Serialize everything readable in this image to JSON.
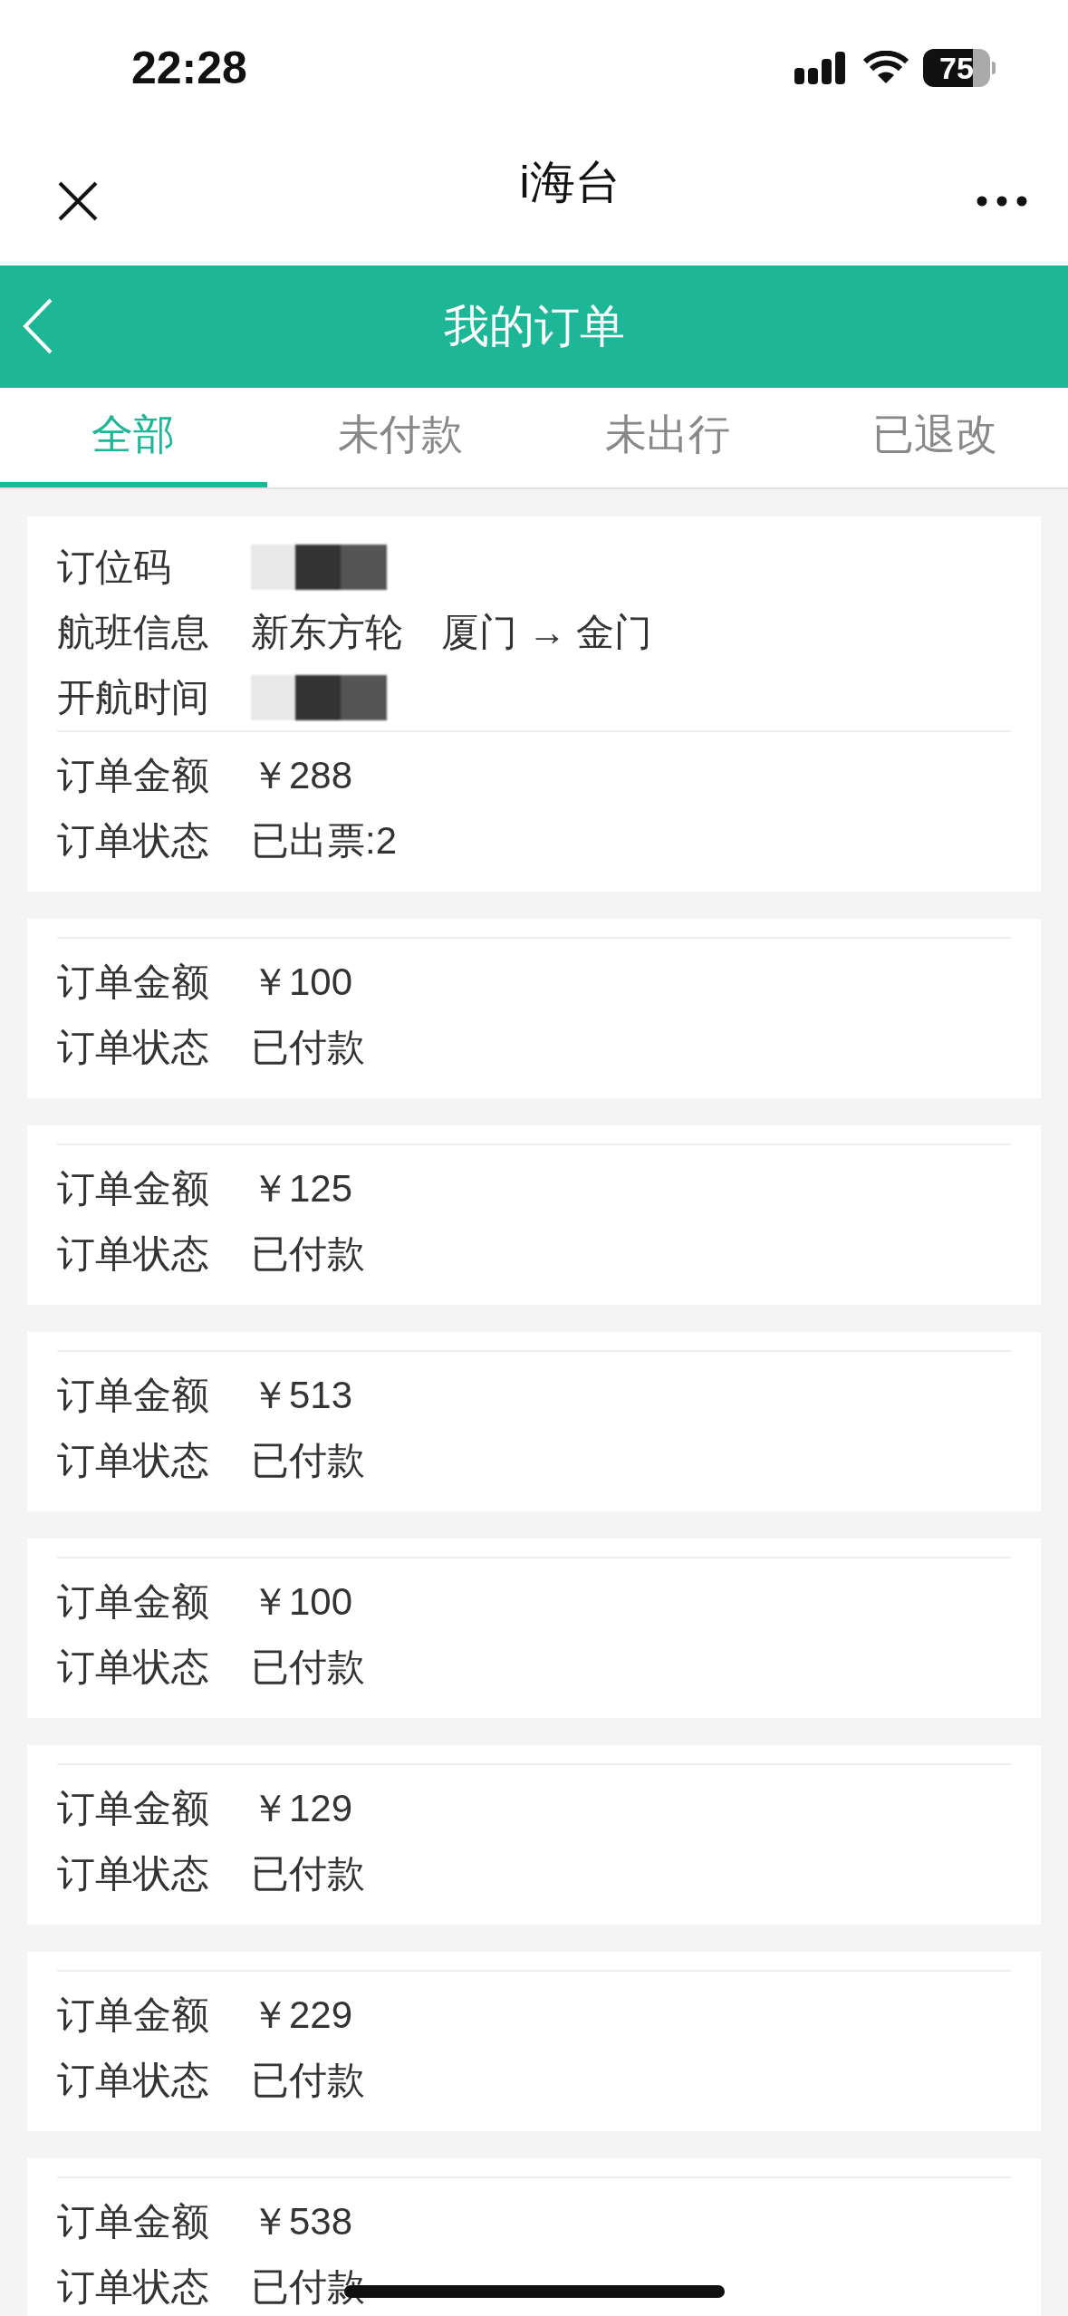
{
  "status_bar": {
    "time": "22:28",
    "battery": "75"
  },
  "nav": {
    "title": "i海台"
  },
  "header": {
    "title": "我的订单"
  },
  "tabs": [
    {
      "label": "全部",
      "selected": true
    },
    {
      "label": "未付款",
      "selected": false
    },
    {
      "label": "未出行",
      "selected": false
    },
    {
      "label": "已退改",
      "selected": false
    }
  ],
  "orders": [
    {
      "details": [
        {
          "label": "订位码",
          "redacted": true
        },
        {
          "label": "航班信息",
          "value": "新东方轮　厦门 → 金门"
        },
        {
          "label": "开航时间",
          "redacted": true
        }
      ],
      "amount_label": "订单金额",
      "amount": "￥288",
      "status_label": "订单状态",
      "status": "已出票:2"
    },
    {
      "amount_label": "订单金额",
      "amount": "￥100",
      "status_label": "订单状态",
      "status": "已付款"
    },
    {
      "amount_label": "订单金额",
      "amount": "￥125",
      "status_label": "订单状态",
      "status": "已付款"
    },
    {
      "amount_label": "订单金额",
      "amount": "￥513",
      "status_label": "订单状态",
      "status": "已付款"
    },
    {
      "amount_label": "订单金额",
      "amount": "￥100",
      "status_label": "订单状态",
      "status": "已付款"
    },
    {
      "amount_label": "订单金额",
      "amount": "￥129",
      "status_label": "订单状态",
      "status": "已付款"
    },
    {
      "amount_label": "订单金额",
      "amount": "￥229",
      "status_label": "订单状态",
      "status": "已付款"
    },
    {
      "amount_label": "订单金额",
      "amount": "￥538",
      "status_label": "订单状态",
      "status": "已付款"
    }
  ]
}
